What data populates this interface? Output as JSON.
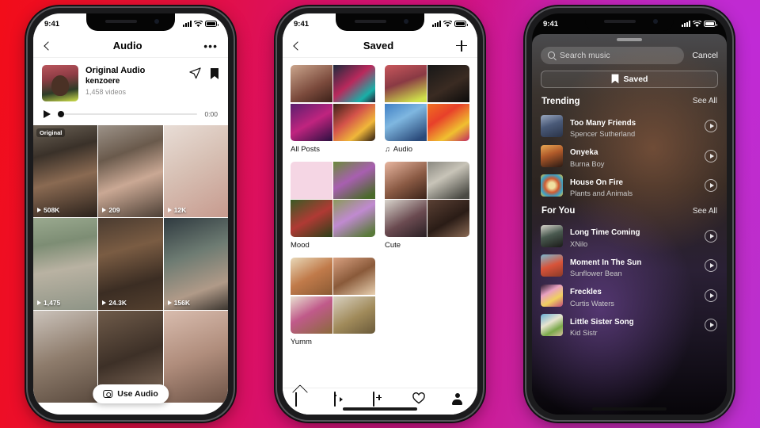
{
  "background": {
    "left_color": "#f20d19",
    "mid_color": "#d4126c",
    "right_color": "#bb2fd2"
  },
  "status_bar": {
    "time": "9:41"
  },
  "phone1": {
    "nav": {
      "back_icon": "chevron-left-icon",
      "title": "Audio",
      "more_icon": "more-options-icon"
    },
    "audio": {
      "title": "Original Audio",
      "username": "kenzoere",
      "video_count": "1,458 videos",
      "share_icon": "share-icon",
      "save_icon": "bookmark-icon",
      "play_icon": "play-icon",
      "time": "0:00"
    },
    "original_badge": "Original",
    "use_audio_label": "Use Audio",
    "grid": [
      {
        "views": "508K",
        "badge": "Original"
      },
      {
        "views": "209"
      },
      {
        "views": "12K"
      },
      {
        "views": "1,475"
      },
      {
        "views": "24.3K"
      },
      {
        "views": "156K"
      }
    ]
  },
  "phone2": {
    "nav": {
      "back_icon": "chevron-left-icon",
      "title": "Saved",
      "add_icon": "plus-icon"
    },
    "collections": [
      {
        "label": "All Posts",
        "icon": null
      },
      {
        "label": "Audio",
        "icon": "music-note-icon"
      },
      {
        "label": "Mood",
        "icon": null
      },
      {
        "label": "Cute",
        "icon": null
      },
      {
        "label": "Yumm",
        "icon": null
      }
    ],
    "tabbar": [
      {
        "name": "home",
        "icon": "home-icon"
      },
      {
        "name": "reels",
        "icon": "reels-icon"
      },
      {
        "name": "create",
        "icon": "plus-square-icon"
      },
      {
        "name": "activity",
        "icon": "heart-icon"
      },
      {
        "name": "profile",
        "icon": "person-icon"
      }
    ]
  },
  "phone3": {
    "search": {
      "placeholder": "Search music",
      "icon": "search-icon"
    },
    "cancel_label": "Cancel",
    "saved_button": {
      "label": "Saved",
      "icon": "bookmark-icon"
    },
    "sections": [
      {
        "title": "Trending",
        "see_all": "See All",
        "tracks": [
          {
            "name": "Too Many Friends",
            "artist": "Spencer Sutherland"
          },
          {
            "name": "Onyeka",
            "artist": "Burna Boy"
          },
          {
            "name": "House On Fire",
            "artist": "Plants and Animals"
          }
        ]
      },
      {
        "title": "For You",
        "see_all": "See All",
        "tracks": [
          {
            "name": "Long Time Coming",
            "artist": "XNilo"
          },
          {
            "name": "Moment In The Sun",
            "artist": "Sunflower Bean"
          },
          {
            "name": "Freckles",
            "artist": "Curtis Waters"
          },
          {
            "name": "Little Sister Song",
            "artist": "Kid Sistr"
          }
        ]
      }
    ]
  }
}
